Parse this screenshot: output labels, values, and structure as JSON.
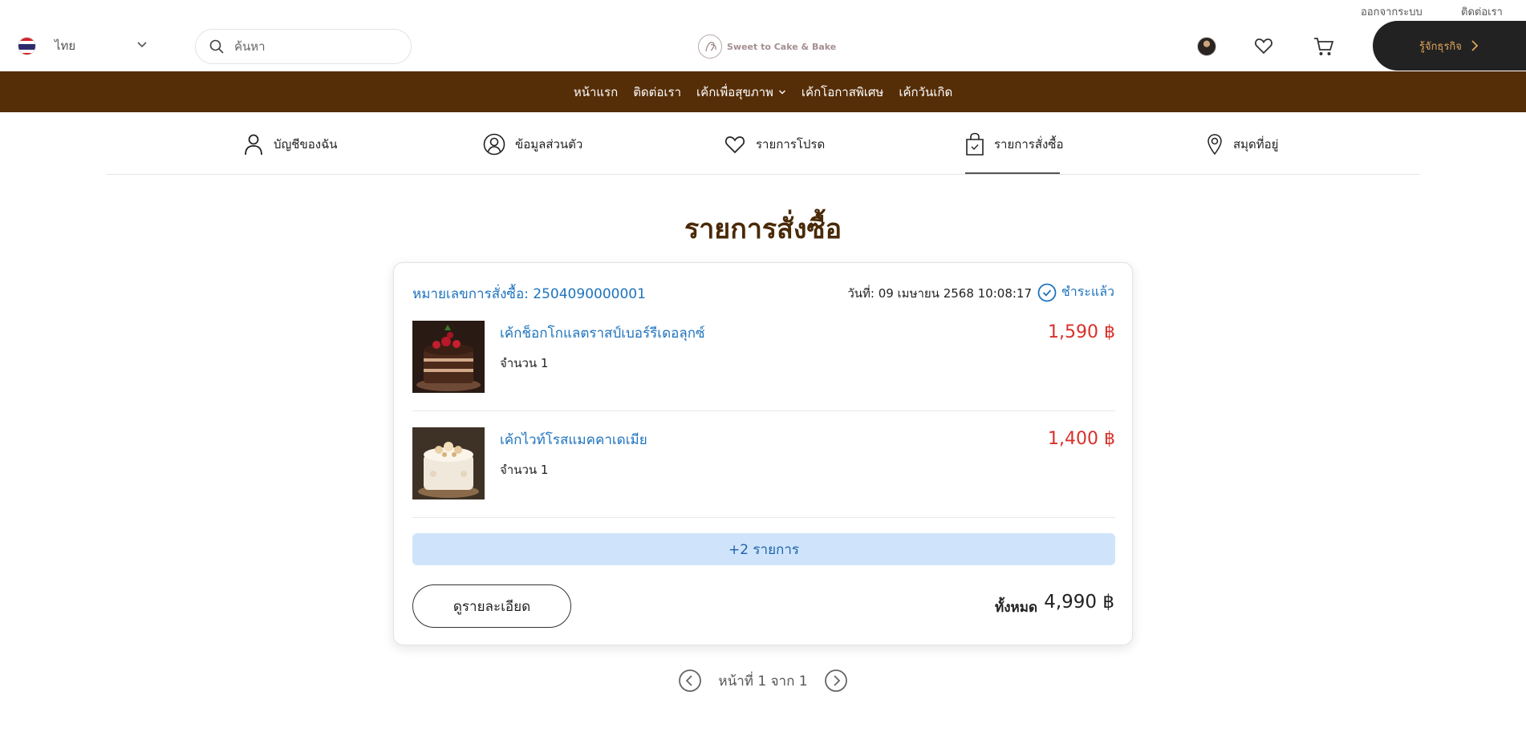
{
  "topbar": {
    "logout": "ออกจากระบบ",
    "contact": "ติดต่อเรา"
  },
  "header": {
    "language": "ไทย",
    "search_placeholder": "ค้นหา",
    "logo_text": "Sweet to Cake & Bake",
    "business_button": "รู้จักธุรกิจ"
  },
  "nav": [
    {
      "label": "หน้าแรก"
    },
    {
      "label": "ติดต่อเรา"
    },
    {
      "label": "เค้กเพื่อสุขภาพ"
    },
    {
      "label": "เค้กโอกาสพิเศษ"
    },
    {
      "label": "เค้กวันเกิด"
    }
  ],
  "tabs": [
    {
      "label": "บัญชีของฉัน",
      "icon": "user-icon"
    },
    {
      "label": "ข้อมูลส่วนตัว",
      "icon": "profile-circle-icon"
    },
    {
      "label": "รายการโปรด",
      "icon": "heart-icon"
    },
    {
      "label": "รายการสั่งซื้อ",
      "icon": "shopping-bag-icon",
      "active": true
    },
    {
      "label": "สมุดที่อยู่",
      "icon": "location-pin-icon"
    }
  ],
  "page_title": "รายการสั่งซื้อ",
  "order": {
    "number_text": "หมายเลขการสั่งซื้อ: 2504090000001",
    "date_text": "วันที่: 09 เมษายน 2568 10:08:17",
    "status": "ชำระแล้ว",
    "items": [
      {
        "name": "เค้กช็อกโกแลตราสป์เบอร์รีเดอลุกซ์",
        "qty": "จำนวน 1",
        "price": "1,590 ฿"
      },
      {
        "name": "เค้กไวท์โรสแมคคาเดเมีย",
        "qty": "จำนวน 1",
        "price": "1,400 ฿"
      }
    ],
    "more_items": "+2 รายการ",
    "detail_button": "ดูรายละเอียด",
    "total_label": "ทั้งหมด",
    "total_value": "4,990 ฿"
  },
  "pagination": {
    "text": "หน้าที่ 1 จาก 1"
  },
  "colors": {
    "nav_bg": "#552d07",
    "link_blue": "#1e73be",
    "price_red": "#d8302a",
    "title_brown": "#4a2a08"
  }
}
